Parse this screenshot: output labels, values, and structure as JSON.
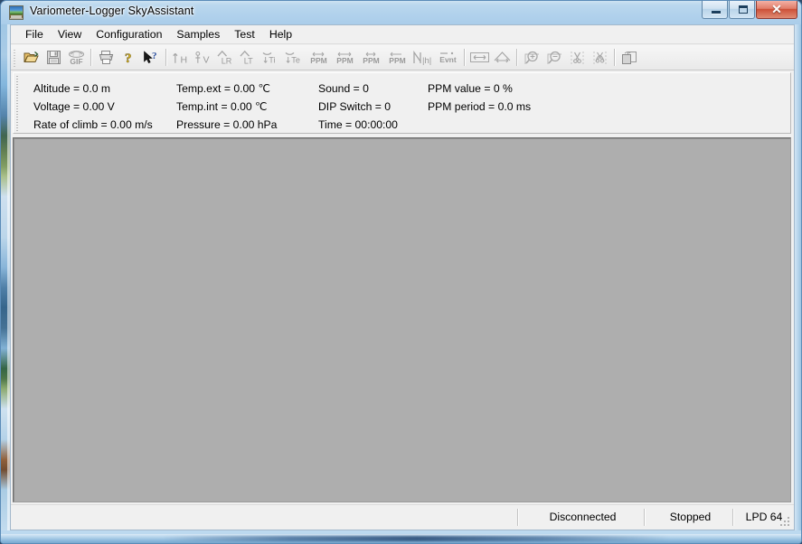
{
  "window": {
    "title": "Variometer-Logger SkyAssistant",
    "icon": "app-landscape-icon",
    "controls": {
      "minimize": "minimize-button",
      "restore": "restore-button",
      "close": "close-button",
      "close_glyph": "✕"
    },
    "accent_close": "#cc4f37",
    "frame_color": "#b2d2ec"
  },
  "menubar": {
    "items": [
      {
        "label": "File",
        "name": "menu-file"
      },
      {
        "label": "View",
        "name": "menu-view"
      },
      {
        "label": "Configuration",
        "name": "menu-configuration"
      },
      {
        "label": "Samples",
        "name": "menu-samples"
      },
      {
        "label": "Test",
        "name": "menu-test"
      },
      {
        "label": "Help",
        "name": "menu-help"
      }
    ]
  },
  "toolbar": {
    "groups": [
      {
        "buttons": [
          {
            "name": "open-folder-icon",
            "label": "",
            "enabled": true
          },
          {
            "name": "save-floppy-icon",
            "label": "",
            "enabled": false
          },
          {
            "name": "export-gif-icon",
            "label": "GIF",
            "enabled": false
          }
        ]
      },
      {
        "buttons": [
          {
            "name": "print-icon",
            "label": "",
            "enabled": false
          },
          {
            "name": "help-question-icon",
            "label": "",
            "enabled": true
          },
          {
            "name": "context-help-arrow-icon",
            "label": "",
            "enabled": true
          }
        ]
      },
      {
        "buttons": [
          {
            "name": "altitude-h-icon",
            "label": "H",
            "enabled": false
          },
          {
            "name": "voltage-v-icon",
            "label": "V",
            "enabled": false
          },
          {
            "name": "rate-lr-icon",
            "label": "LR",
            "enabled": false
          },
          {
            "name": "rate-lt-icon",
            "label": "LT",
            "enabled": false
          },
          {
            "name": "temp-int-ti-icon",
            "label": "Ti",
            "enabled": false
          },
          {
            "name": "temp-ext-te-icon",
            "label": "Te",
            "enabled": false
          },
          {
            "name": "ppm-value-icon",
            "label": "PPM",
            "enabled": false
          },
          {
            "name": "ppm-period-icon",
            "label": "PPM",
            "enabled": false
          },
          {
            "name": "ppm-width-icon",
            "label": "PPM",
            "enabled": false
          },
          {
            "name": "ppm-range-icon",
            "label": "PPM",
            "enabled": false
          },
          {
            "name": "noise-nh-icon",
            "label": "N|h|",
            "enabled": false
          },
          {
            "name": "event-evnt-icon",
            "label": "Evnt",
            "enabled": false
          }
        ]
      },
      {
        "buttons": [
          {
            "name": "measure-width-icon",
            "label": "",
            "enabled": false
          },
          {
            "name": "measure-peak-icon",
            "label": "",
            "enabled": false
          }
        ]
      },
      {
        "buttons": [
          {
            "name": "zoom-in-icon",
            "label": "",
            "enabled": false
          },
          {
            "name": "zoom-out-icon",
            "label": "",
            "enabled": false
          },
          {
            "name": "cut-scissors-icon",
            "label": "",
            "enabled": false
          },
          {
            "name": "trim-selection-icon",
            "label": "",
            "enabled": false
          }
        ]
      },
      {
        "buttons": [
          {
            "name": "copy-page-icon",
            "label": "",
            "enabled": false
          }
        ]
      }
    ]
  },
  "readings": {
    "column1": [
      "Altitude = 0.0 m",
      "Voltage = 0.00 V",
      "Rate of climb = 0.00 m/s"
    ],
    "column2": [
      "Temp.ext = 0.00 ℃",
      "Temp.int = 0.00 ℃",
      "Pressure = 0.00 hPa"
    ],
    "column3": [
      "Sound = 0",
      "DIP Switch = 0",
      "Time = 00:00:00"
    ],
    "column4": [
      "PPM value = 0 %",
      "PPM period = 0.0 ms"
    ]
  },
  "statusbar": {
    "connection": "Disconnected",
    "recording": "Stopped",
    "device": "LPD 64",
    "resize_grip": "resize-grip-icon"
  }
}
